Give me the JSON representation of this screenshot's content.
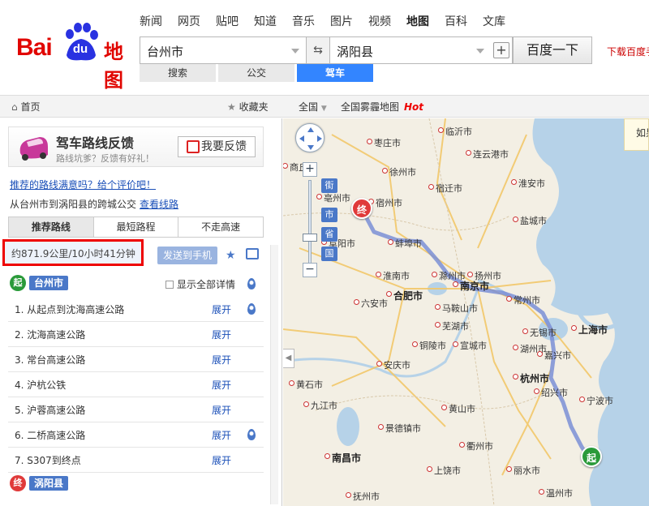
{
  "brand": {
    "logo_left": "Bai",
    "logo_paw": "du",
    "logo_right": "地图"
  },
  "topnav": [
    "新闻",
    "网页",
    "贴吧",
    "知道",
    "音乐",
    "图片",
    "视频",
    "地图",
    "百科",
    "文库"
  ],
  "topnav_active": "地图",
  "search": {
    "from_value": "台州市",
    "to_value": "涡阳县",
    "submit_label": "百度一下",
    "download_text": "下载百度手"
  },
  "mode_tabs": [
    {
      "label": "搜索",
      "active": false
    },
    {
      "label": "公交",
      "active": false
    },
    {
      "label": "驾车",
      "active": true
    }
  ],
  "toolbar": {
    "home_label": "首页",
    "favorites_label": "收藏夹",
    "region_label": "全国",
    "smog_label": "全国雾霾地图",
    "hot_label": "Hot"
  },
  "feedback_banner": {
    "title": "驾车路线反馈",
    "subtitle": "路线坑爹？反馈有好礼！",
    "button_label": "我要反馈"
  },
  "rate_link": "推荐的路线满意吗？给个评价吧！",
  "transit_text": "从台州市到涡阳县的跨城公交",
  "transit_link": "查看线路",
  "route_tabs": [
    {
      "label": "推荐路线",
      "active": true
    },
    {
      "label": "最短路程",
      "active": false
    },
    {
      "label": "不走高速",
      "active": false
    }
  ],
  "summary": "约871.9公里/10小时41分钟",
  "send_to_phone": "发送到手机",
  "start": {
    "badge": "起",
    "city": "台州市"
  },
  "show_all_details": "显示全部详情",
  "steps": [
    {
      "text": "1. 从起点到沈海高速公路",
      "action": "展开",
      "pin": true
    },
    {
      "text": "2. 沈海高速公路",
      "action": "展开",
      "pin": false
    },
    {
      "text": "3. 常台高速公路",
      "action": "展开",
      "pin": false
    },
    {
      "text": "4. 沪杭公铁",
      "action": "展开",
      "pin": false
    },
    {
      "text": "5. 沪蓉高速公路",
      "action": "展开",
      "pin": false
    },
    {
      "text": "6. 二桥高速公路",
      "action": "展开",
      "pin": true
    },
    {
      "text": "7. S307到终点",
      "action": "展开",
      "pin": false
    }
  ],
  "end": {
    "badge": "终",
    "city": "涡阳县"
  },
  "map": {
    "zoom_tags": [
      "街",
      "市",
      "省",
      "国"
    ],
    "right_tip": "如果",
    "start_marker": "起",
    "end_marker": "终",
    "labels": [
      {
        "text": "临沂市",
        "big": false
      },
      {
        "text": "枣庄市",
        "big": false
      },
      {
        "text": "连云港市",
        "big": false
      },
      {
        "text": "商丘市",
        "big": false
      },
      {
        "text": "徐州市",
        "big": false
      },
      {
        "text": "亳州市",
        "big": false
      },
      {
        "text": "宿州市",
        "big": false
      },
      {
        "text": "宿迁市",
        "big": false
      },
      {
        "text": "淮安市",
        "big": false
      },
      {
        "text": "盐城市",
        "big": false
      },
      {
        "text": "阜阳市",
        "big": false
      },
      {
        "text": "蚌埠市",
        "big": false
      },
      {
        "text": "淮南市",
        "big": false
      },
      {
        "text": "滁州市",
        "big": false
      },
      {
        "text": "扬州市",
        "big": false
      },
      {
        "text": "合肥市",
        "big": true
      },
      {
        "text": "南京市",
        "big": true
      },
      {
        "text": "六安市",
        "big": false
      },
      {
        "text": "马鞍山市",
        "big": false
      },
      {
        "text": "常州市",
        "big": false
      },
      {
        "text": "芜湖市",
        "big": false
      },
      {
        "text": "无锡市",
        "big": false
      },
      {
        "text": "上海市",
        "big": true
      },
      {
        "text": "铜陵市",
        "big": false
      },
      {
        "text": "宣城市",
        "big": false
      },
      {
        "text": "湖州市",
        "big": false
      },
      {
        "text": "嘉兴市",
        "big": false
      },
      {
        "text": "安庆市",
        "big": false
      },
      {
        "text": "杭州市",
        "big": true
      },
      {
        "text": "黄石市",
        "big": false
      },
      {
        "text": "绍兴市",
        "big": false
      },
      {
        "text": "宁波市",
        "big": false
      },
      {
        "text": "九江市",
        "big": false
      },
      {
        "text": "黄山市",
        "big": false
      },
      {
        "text": "景德镇市",
        "big": false
      },
      {
        "text": "衢州市",
        "big": false
      },
      {
        "text": "南昌市",
        "big": true
      },
      {
        "text": "上饶市",
        "big": false
      },
      {
        "text": "丽水市",
        "big": false
      },
      {
        "text": "抚州市",
        "big": false
      },
      {
        "text": "温州市",
        "big": false
      }
    ]
  },
  "colors": {
    "brand_red": "#e10601",
    "accent_blue": "#3385ff",
    "route_blue": "#7a8fd6"
  }
}
